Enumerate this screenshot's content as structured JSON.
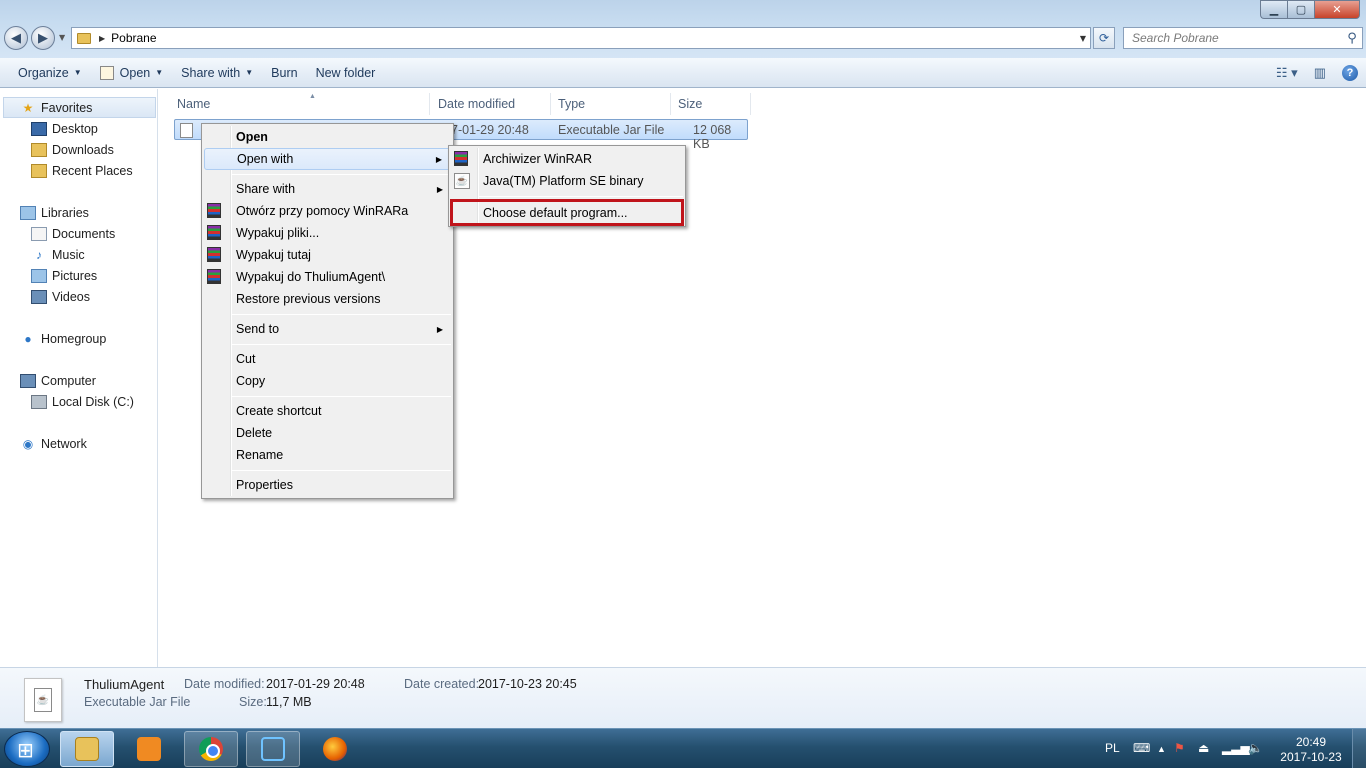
{
  "address": {
    "path": "Pobrane"
  },
  "search": {
    "placeholder": "Search Pobrane"
  },
  "commands": {
    "organize": "Organize",
    "open": "Open",
    "share_with": "Share with",
    "burn": "Burn",
    "new_folder": "New folder"
  },
  "nav": {
    "favorites": "Favorites",
    "desktop": "Desktop",
    "downloads": "Downloads",
    "recent_places": "Recent Places",
    "libraries": "Libraries",
    "documents": "Documents",
    "music": "Music",
    "pictures": "Pictures",
    "videos": "Videos",
    "homegroup": "Homegroup",
    "computer": "Computer",
    "local_disk": "Local Disk (C:)",
    "network": "Network"
  },
  "columns": {
    "name": "Name",
    "date_modified": "Date modified",
    "type": "Type",
    "size": "Size"
  },
  "file": {
    "date_visible": "7-01-29 20:48",
    "type": "Executable Jar File",
    "size": "12 068 KB"
  },
  "context_menu": {
    "open": "Open",
    "open_with": "Open with",
    "share_with": "Share with",
    "winrar_open": "Otwórz przy pomocy WinRARa",
    "extract_files": "Wypakuj pliki...",
    "extract_here": "Wypakuj tutaj",
    "extract_to": "Wypakuj do ThuliumAgent\\",
    "restore": "Restore previous versions",
    "send_to": "Send to",
    "cut": "Cut",
    "copy": "Copy",
    "create_shortcut": "Create shortcut",
    "delete": "Delete",
    "rename": "Rename",
    "properties": "Properties"
  },
  "submenu": {
    "winrar": "Archiwizer WinRAR",
    "java": "Java(TM) Platform SE binary",
    "choose_default": "Choose default program..."
  },
  "details": {
    "name": "ThuliumAgent",
    "type": "Executable Jar File",
    "date_modified_label": "Date modified:",
    "date_modified": "2017-01-29 20:48",
    "date_created_label": "Date created:",
    "date_created": "2017-10-23 20:45",
    "size_label": "Size:",
    "size": "11,7 MB"
  },
  "tray": {
    "language": "PL",
    "time": "20:49",
    "date": "2017-10-23"
  },
  "colors": {
    "highlight_outline": "#c0141b",
    "selection": "#c1dcfc",
    "taskbar": "#25506f"
  }
}
